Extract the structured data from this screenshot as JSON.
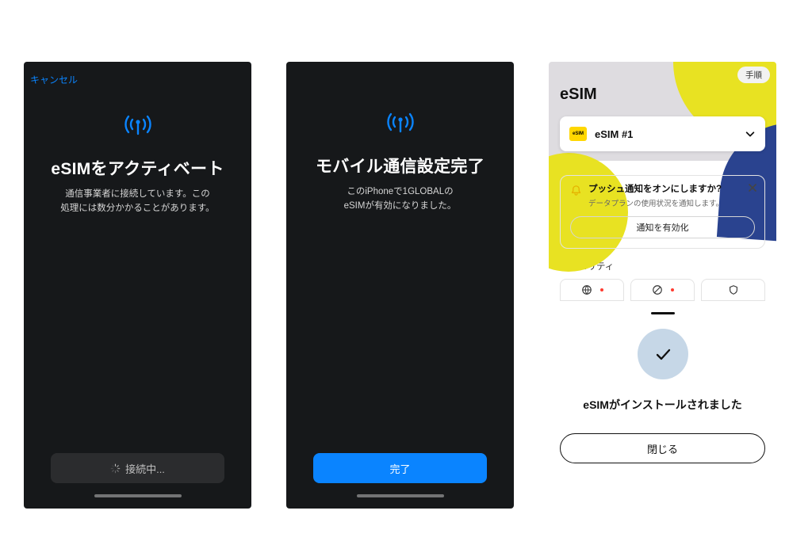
{
  "screen1": {
    "cancel": "キャンセル",
    "title": "eSIMをアクティベート",
    "subtitle": "通信事業者に接続しています。この\n処理には数分かかることがあります。",
    "connecting": "接続中..."
  },
  "screen2": {
    "title": "モバイル通信設定完了",
    "subtitle": "このiPhoneで1GLOBALの\neSIMが有効になりました。",
    "done": "完了"
  },
  "screen3": {
    "steps_pill": "手順",
    "header_title": "eSIM",
    "card_label": "eSIM #1",
    "esim_badge": "eSIM",
    "push": {
      "title": "プッシュ通知をオンにしますか?",
      "desc": "データプランの使用状況を通知します。",
      "enable": "通知を有効化"
    },
    "security_label": "セキュリティ",
    "sheet": {
      "title": "eSIMがインストールされました",
      "close": "閉じる"
    }
  }
}
